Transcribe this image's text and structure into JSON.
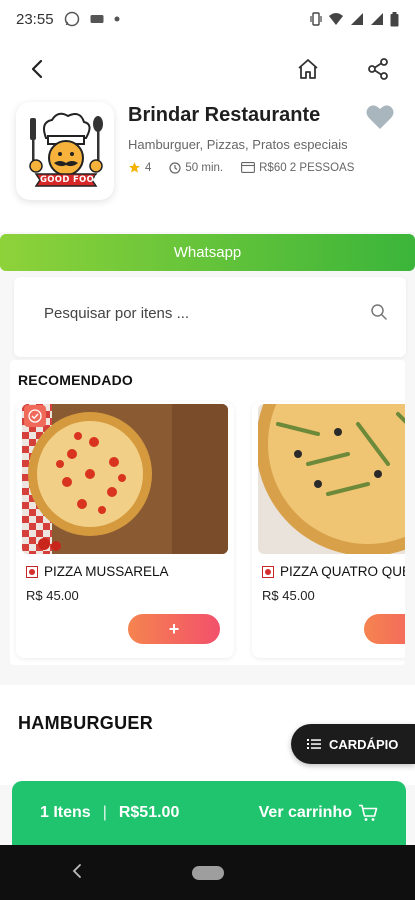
{
  "status_bar": {
    "time": "23:55",
    "left_icons": [
      "whatsapp-icon",
      "message-icon",
      "dot-icon"
    ],
    "right_icons": [
      "vibrate-icon",
      "wifi-icon",
      "signal-icon",
      "signal-icon",
      "battery-icon"
    ]
  },
  "nav": {
    "back_icon": "chevron-left-icon",
    "home_icon": "home-icon",
    "share_icon": "share-icon"
  },
  "restaurant": {
    "name": "Brindar Restaurante",
    "categories": "Hamburguer, Pizzas, Pratos especiais",
    "rating": "4",
    "delivery_time": "50 min.",
    "price_for_two": "R$60 2 PESSOAS",
    "logo_text": "GOOD FOOD"
  },
  "whatsapp": {
    "label": "Whatsapp"
  },
  "search": {
    "placeholder": "Pesquisar por itens ..."
  },
  "recommended": {
    "title": "RECOMENDADO",
    "items": [
      {
        "name": "PIZZA MUSSARELA",
        "price": "R$ 45.00",
        "add_label": "+"
      },
      {
        "name": "PIZZA QUATRO QUE",
        "price": "R$ 45.00",
        "add_label": "+"
      }
    ]
  },
  "section": {
    "title": "HAMBURGUER"
  },
  "menu_button": {
    "label": "CARDÁPIO"
  },
  "cart": {
    "items": "1 Itens",
    "separator": "|",
    "total": "R$51.00",
    "action": "Ver carrinho"
  },
  "colors": {
    "whatsapp_start": "#8ed23a",
    "whatsapp_end": "#3bb53a",
    "cart_green": "#21c46e",
    "add_button_start": "#f5844f",
    "add_button_end": "#f2506b",
    "rating_star": "#f5b301"
  }
}
